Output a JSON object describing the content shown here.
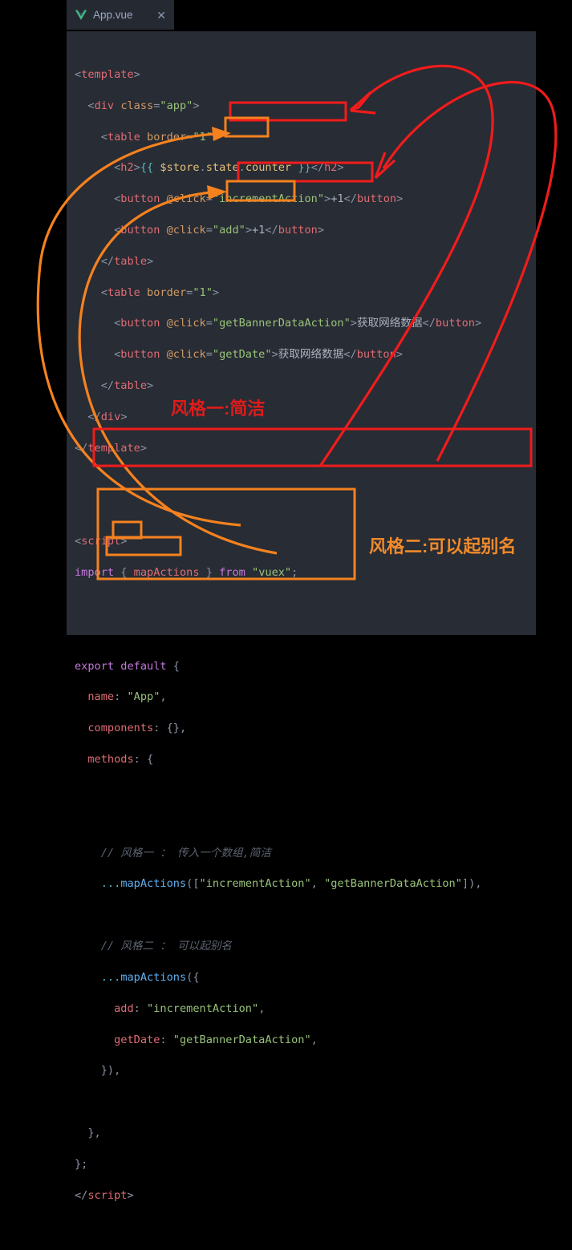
{
  "window": {
    "background": "#000000",
    "editor_background": "#282c34",
    "tabbar_background": "#252932"
  },
  "tab": {
    "icon": "vue-logo-icon",
    "title": "App.vue",
    "close_label": "✕"
  },
  "code": {
    "language": "vue",
    "lines": [
      "<template>",
      "  <div class=\"app\">",
      "    <table border=\"1\">",
      "      <h2>{{ $store.state.counter }}</h2>",
      "      <button @click=\"incrementAction\">+1</button>",
      "      <button @click=\"add\">+1</button>",
      "    </table>",
      "    <table border=\"1\">",
      "      <button @click=\"getBannerDataAction\">获取网络数据</button>",
      "      <button @click=\"getDate\">获取网络数据</button>",
      "    </table>",
      "  </div>",
      "</template>",
      "",
      "",
      "<script>",
      "import { mapActions } from \"vuex\";",
      "",
      "",
      "export default {",
      "  name: \"App\",",
      "  components: {},",
      "  methods: {",
      "",
      "",
      "    // 风格一 ： 传入一个数组,简洁",
      "    ...mapActions([\"incrementAction\", \"getBannerDataAction\"]),",
      "",
      "    // 风格二 ： 可以起别名",
      "    ...mapActions({",
      "      add: \"incrementAction\",",
      "      getDate: \"getBannerDataAction\",",
      "    }),",
      "",
      "  },",
      "};",
      "</script>"
    ]
  },
  "annotations": {
    "labels": [
      {
        "id": "style1",
        "text": "风格一:简洁",
        "color": "#e01b1b"
      },
      {
        "id": "style2",
        "text": "风格二:可以起别名",
        "color": "#f08a2b"
      }
    ],
    "red_boxes": [
      "incrementAction-attr-box",
      "getBannerDataAction-attr-box",
      "mapActions-array-box"
    ],
    "orange_boxes": [
      "add-attr-box",
      "getDate-attr-box",
      "mapActions-object-box",
      "add-alias-box",
      "getDate-alias-box"
    ],
    "colors": {
      "red": "#f01c1c",
      "orange": "#f5821f"
    }
  }
}
